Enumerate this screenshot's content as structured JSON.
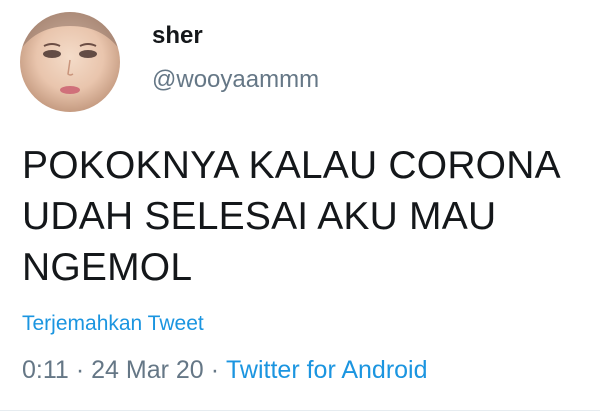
{
  "user": {
    "display_name": "sher",
    "handle": "@wooyaammm"
  },
  "tweet": {
    "lines": [
      "POKOKNYA KALAU CORONA",
      "UDAH SELESAI AKU MAU",
      "NGEMOL"
    ],
    "translate_label": "Terjemahkan Tweet",
    "time": "0:11",
    "separator": "·",
    "date": "24 Mar 20",
    "source": "Twitter for Android"
  },
  "colors": {
    "link": "#1b95e0",
    "secondary_text": "#657786",
    "primary_text": "#14171a"
  }
}
